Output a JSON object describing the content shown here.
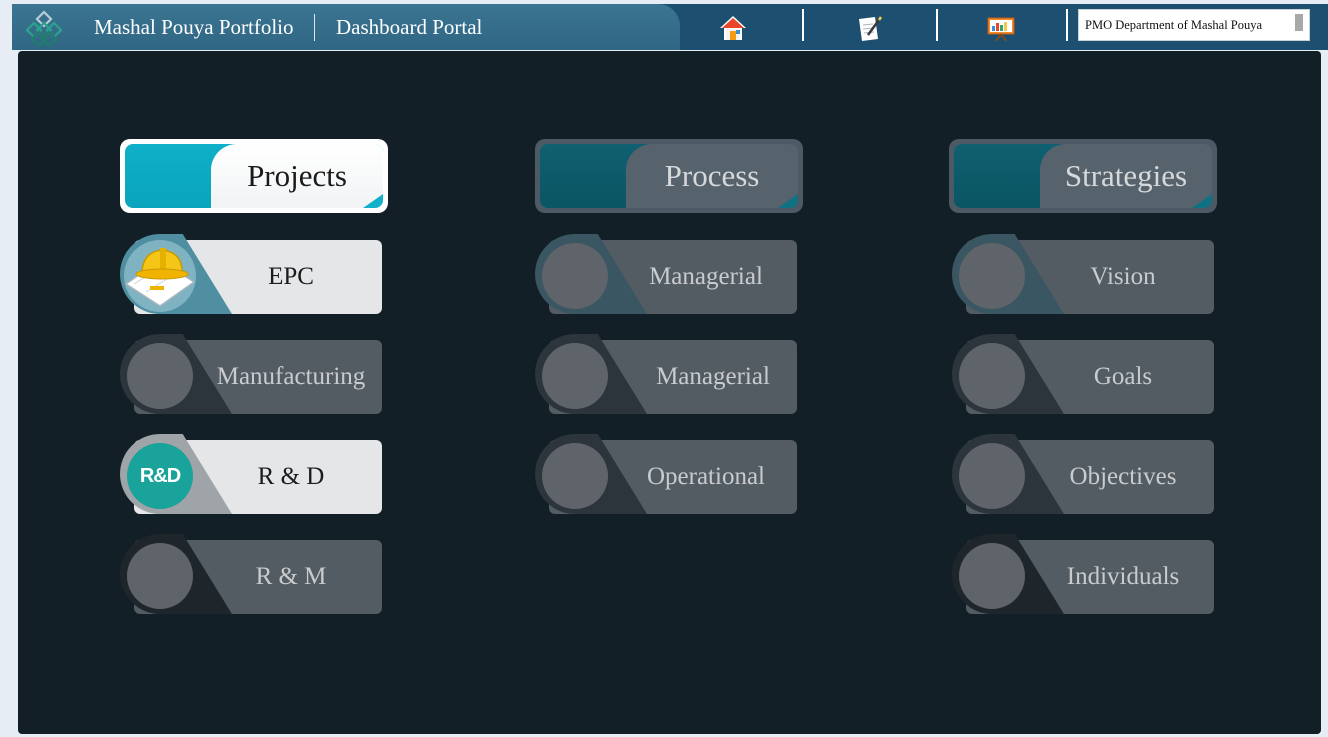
{
  "header": {
    "app_title": "Mashal Pouya Portfolio",
    "portal_title": "Dashboard Portal",
    "nav_icons": [
      "home-icon",
      "edit-document-icon",
      "presentation-icon"
    ],
    "department": "PMO Department of Mashal Pouya"
  },
  "columns": {
    "projects": {
      "title": "Projects",
      "items": [
        "EPC",
        "Manufacturing",
        "R & D",
        "R & M"
      ],
      "rd_badge": "R&D"
    },
    "process": {
      "title": "Process",
      "items": [
        "Managerial",
        "Managerial",
        "Operational"
      ]
    },
    "strategies": {
      "title": "Strategies",
      "items": [
        "Vision",
        "Goals",
        "Objectives",
        "Individuals"
      ]
    }
  },
  "colors": {
    "header_bar": "#1d5070",
    "panel_bg": "#121f27",
    "accent_teal": "#0fb0c8",
    "inactive_button": "#545c63"
  }
}
